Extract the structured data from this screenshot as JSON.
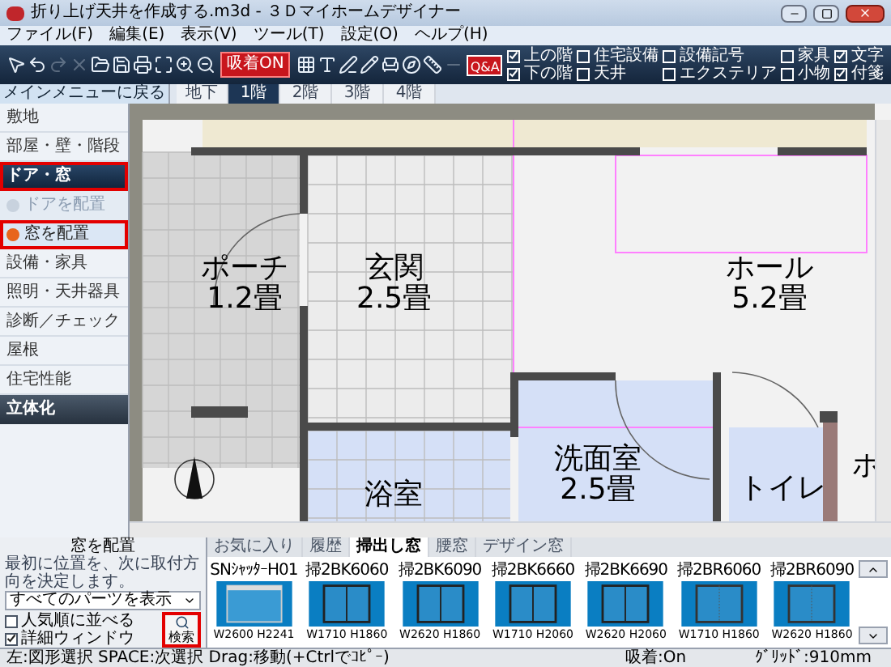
{
  "window": {
    "title": "折り上げ天井を作成する.m3d - ３Ｄマイホームデザイナー"
  },
  "menu": [
    "ファイル(F)",
    "編集(E)",
    "表示(V)",
    "ツール(T)",
    "設定(O)",
    "ヘルプ(H)"
  ],
  "toolbar": {
    "tools": [
      {
        "disabled": false
      },
      {
        "disabled": false
      },
      {
        "disabled": true
      },
      {
        "disabled": true
      },
      {
        "disabled": false
      },
      {
        "disabled": false
      },
      {
        "disabled": false
      },
      {
        "disabled": false
      },
      {
        "disabled": false
      },
      {
        "disabled": false
      },
      {
        "disabled": false
      },
      {
        "disabled": false
      },
      {
        "disabled": false
      },
      {
        "disabled": false
      },
      {
        "disabled": false
      },
      {
        "disabled": false
      },
      {
        "disabled": false
      },
      {
        "disabled": true
      }
    ],
    "snap_button": {
      "label": "吸着ON",
      "on": true
    },
    "qa_label": "Q&A",
    "layers": [
      {
        "label": "上の階",
        "checked": true
      },
      {
        "label": "住宅設備",
        "checked": false
      },
      {
        "label": "設備記号",
        "checked": false
      },
      {
        "label": "家具",
        "checked": false
      },
      {
        "label": "文字",
        "checked": true
      },
      {
        "label": "下の階",
        "checked": true
      },
      {
        "label": "天井",
        "checked": false
      },
      {
        "label": "エクステリア",
        "checked": false
      },
      {
        "label": "小物",
        "checked": false
      },
      {
        "label": "付箋",
        "checked": true
      }
    ]
  },
  "back_button": "メインメニューに戻る",
  "floor_tabs": [
    {
      "label": "地下",
      "selected": false
    },
    {
      "label": "1階",
      "selected": true
    },
    {
      "label": "2階",
      "selected": false
    },
    {
      "label": "3階",
      "selected": false
    },
    {
      "label": "4階",
      "selected": false
    }
  ],
  "sidebar": {
    "items": [
      {
        "kind": "item",
        "label": "敷地",
        "selected": false,
        "highlighted": false
      },
      {
        "kind": "item",
        "label": "部屋・壁・階段",
        "selected": false,
        "highlighted": false
      },
      {
        "kind": "header",
        "label": "ドア・窓",
        "selected": true,
        "highlighted": true
      },
      {
        "kind": "subitem",
        "label": "ドアを配置",
        "selected": false,
        "highlighted": false
      },
      {
        "kind": "subitem",
        "label": "窓を配置",
        "selected": true,
        "highlighted": true
      },
      {
        "kind": "item",
        "label": "設備・家具",
        "selected": false,
        "highlighted": false
      },
      {
        "kind": "item",
        "label": "照明・天井器具",
        "selected": false,
        "highlighted": false
      },
      {
        "kind": "item",
        "label": "診断／チェック",
        "selected": false,
        "highlighted": false
      },
      {
        "kind": "item",
        "label": "屋根",
        "selected": false,
        "highlighted": false
      },
      {
        "kind": "item",
        "label": "住宅性能",
        "selected": false,
        "highlighted": false
      },
      {
        "kind": "header",
        "label": "立体化",
        "selected": false,
        "highlighted": false
      }
    ]
  },
  "plan": {
    "rooms": [
      {
        "name": "ポーチ",
        "size": "1.2畳"
      },
      {
        "name": "玄関",
        "size": "2.5畳"
      },
      {
        "name": "ホール",
        "size": "5.2畳"
      },
      {
        "name": "浴室"
      },
      {
        "name": "洗面室",
        "size": "2.5畳"
      },
      {
        "name": "トイレ"
      },
      {
        "name": "ホ"
      }
    ]
  },
  "placement_panel": {
    "title": "窓を配置",
    "hint": "最初に位置を、次に取付方向を決定します。",
    "filter": "すべてのパーツを表示",
    "options": [
      {
        "label": "人気順に並べる",
        "checked": false
      },
      {
        "label": "詳細ウィンドウ",
        "checked": true
      }
    ],
    "search_button": {
      "label": "検索",
      "highlighted": true
    }
  },
  "palette": {
    "tabs": [
      {
        "label": "お気に入り",
        "selected": false
      },
      {
        "label": "履歴",
        "selected": false
      },
      {
        "label": "掃出し窓",
        "selected": true
      },
      {
        "label": "腰窓",
        "selected": false
      },
      {
        "label": "デザイン窓",
        "selected": false
      }
    ],
    "items": [
      {
        "kind": "shutter",
        "name": "SNｼｬｯﾀｰH01",
        "size": "W2600 H2241"
      },
      {
        "kind": "double",
        "name": "掃2BK6060",
        "size": "W1710 H1860"
      },
      {
        "kind": "double",
        "name": "掃2BK6090",
        "size": "W2620 H1860"
      },
      {
        "kind": "double",
        "name": "掃2BK6660",
        "size": "W1710 H2060"
      },
      {
        "kind": "double",
        "name": "掃2BK6690",
        "size": "W2620 H2060"
      },
      {
        "kind": "single",
        "name": "掃2BR6060",
        "size": "W1710 H1860"
      },
      {
        "kind": "single",
        "name": "掃2BR6090",
        "size": "W2620 H1860"
      }
    ]
  },
  "status_bar": {
    "hint": "左:図形選択 SPACE:次選択 Drag:移動(+Ctrlでｺﾋﾟｰ)",
    "snap": "吸着:On",
    "grid": "ｸﾞﾘｯﾄﾞ:910mm"
  }
}
